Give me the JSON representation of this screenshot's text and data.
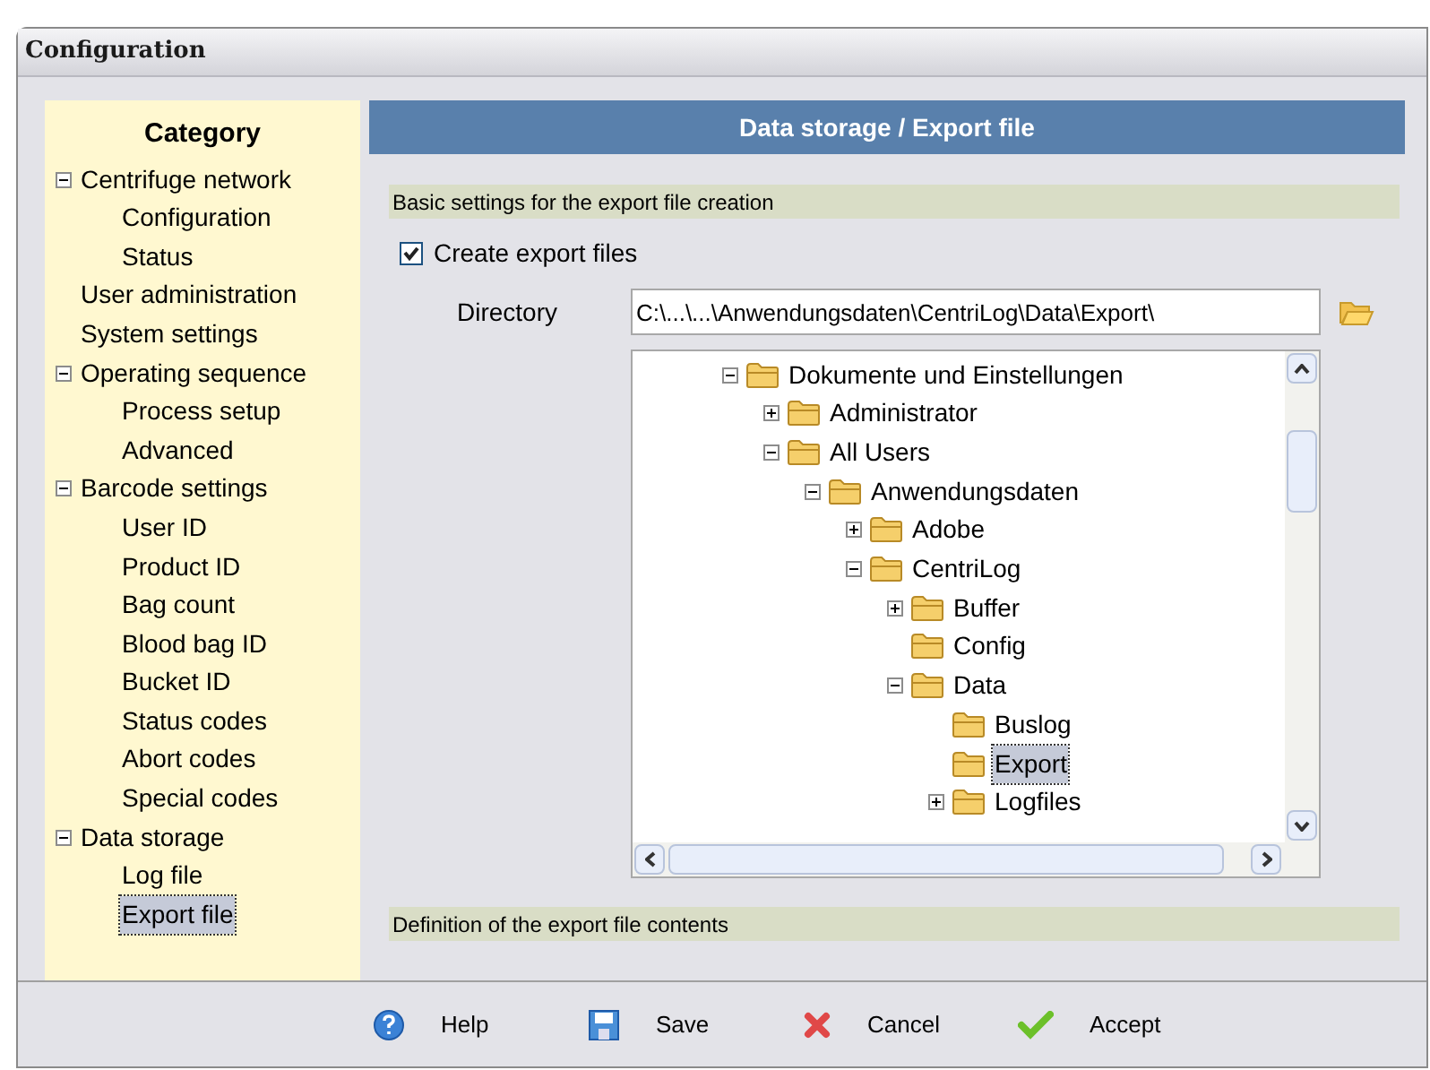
{
  "window": {
    "title": "Configuration"
  },
  "sidebar": {
    "title": "Category",
    "items": [
      {
        "label": "Centrifuge network",
        "expanded": true,
        "selected": false,
        "children": [
          {
            "label": "Configuration",
            "selected": false
          },
          {
            "label": "Status",
            "selected": false
          }
        ]
      },
      {
        "label": "User administration",
        "selected": false
      },
      {
        "label": "System settings",
        "selected": false
      },
      {
        "label": "Operating sequence",
        "expanded": true,
        "selected": false,
        "children": [
          {
            "label": "Process setup",
            "selected": false
          },
          {
            "label": "Advanced",
            "selected": false
          }
        ]
      },
      {
        "label": "Barcode settings",
        "expanded": true,
        "selected": false,
        "children": [
          {
            "label": "User ID",
            "selected": false
          },
          {
            "label": "Product ID",
            "selected": false
          },
          {
            "label": "Bag count",
            "selected": false
          },
          {
            "label": "Blood bag ID",
            "selected": false
          },
          {
            "label": "Bucket ID",
            "selected": false
          },
          {
            "label": "Status codes",
            "selected": false
          },
          {
            "label": "Abort codes",
            "selected": false
          },
          {
            "label": "Special codes",
            "selected": false
          }
        ]
      },
      {
        "label": "Data storage",
        "expanded": true,
        "selected": false,
        "children": [
          {
            "label": "Log file",
            "selected": false
          },
          {
            "label": "Export file",
            "selected": true
          }
        ]
      }
    ]
  },
  "panel": {
    "title": "Data storage / Export file",
    "section_1": "Basic settings for the export file creation",
    "create_export": {
      "label": "Create export files",
      "checked": true
    },
    "directory": {
      "label": "Directory",
      "value": "C:\\...\\...\\Anwendungsdaten\\CentriLog\\Data\\Export\\"
    },
    "folders": [
      {
        "label": "Dokumente und Einstellungen",
        "expanded": true,
        "selected": false,
        "children": [
          {
            "label": "Administrator",
            "expanded": false,
            "selected": false
          },
          {
            "label": "All Users",
            "expanded": true,
            "selected": false,
            "children": [
              {
                "label": "Anwendungsdaten",
                "expanded": true,
                "selected": false,
                "children": [
                  {
                    "label": "Adobe",
                    "expanded": false,
                    "selected": false
                  },
                  {
                    "label": "CentriLog",
                    "expanded": true,
                    "selected": false,
                    "children": [
                      {
                        "label": "Buffer",
                        "expanded": false,
                        "selected": false
                      },
                      {
                        "label": "Config",
                        "selected": false
                      },
                      {
                        "label": "Data",
                        "expanded": true,
                        "selected": false,
                        "children": [
                          {
                            "label": "Buslog",
                            "selected": false
                          },
                          {
                            "label": "Export",
                            "selected": true
                          },
                          {
                            "label": "Logfiles",
                            "expanded": false,
                            "selected": false
                          }
                        ]
                      }
                    ]
                  }
                ]
              }
            ]
          }
        ]
      }
    ],
    "section_2": "Definition of the export file contents"
  },
  "buttons": [
    {
      "kind": "help",
      "label": "Help"
    },
    {
      "kind": "save",
      "label": "Save"
    },
    {
      "kind": "cancel",
      "label": "Cancel"
    },
    {
      "kind": "accept",
      "label": "Accept"
    }
  ]
}
